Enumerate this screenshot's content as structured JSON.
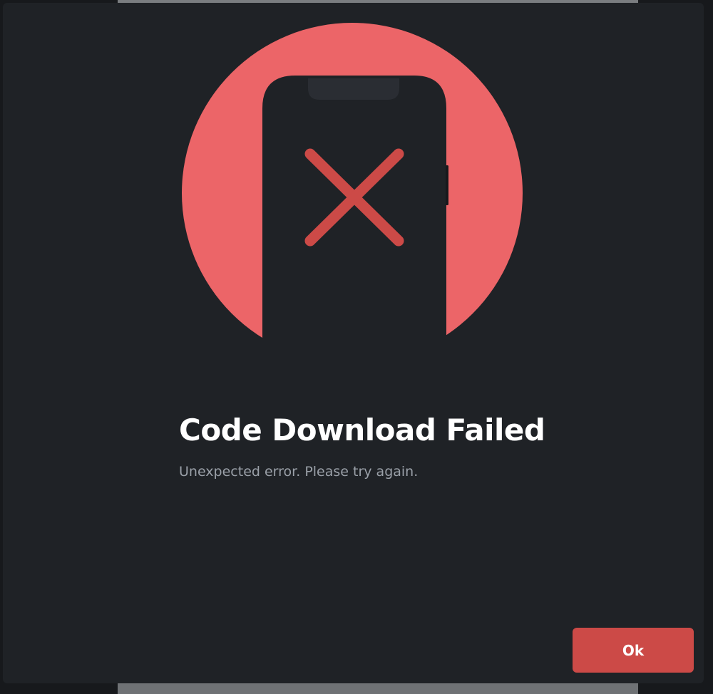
{
  "dialog": {
    "title": "Code Download Failed",
    "message": "Unexpected error. Please try again.",
    "ok_label": "Ok"
  },
  "illustration": {
    "name": "phone-error-icon",
    "circle_color": "#ec6568",
    "phone_color": "#1f2226",
    "cross_color": "#cc4a47"
  },
  "colors": {
    "modal_background": "#1f2226",
    "button_background": "#cc4a47",
    "title_text": "#ffffff",
    "message_text": "#9aa0a8"
  }
}
